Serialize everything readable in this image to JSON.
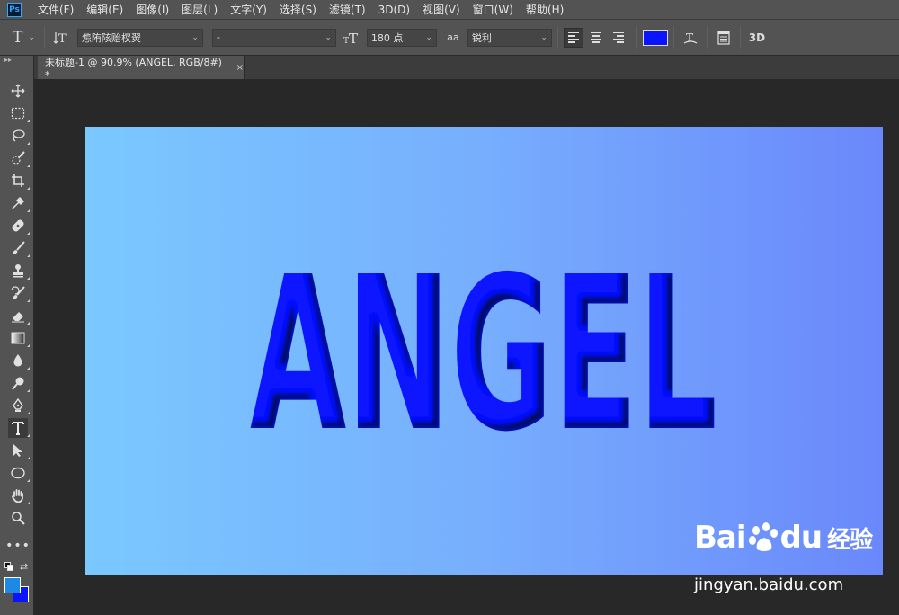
{
  "app": {
    "logo_text": "Ps"
  },
  "menu": {
    "items": [
      "文件(F)",
      "编辑(E)",
      "图像(I)",
      "图层(L)",
      "文字(Y)",
      "选择(S)",
      "滤镜(T)",
      "3D(D)",
      "视图(V)",
      "窗口(W)",
      "帮助(H)"
    ]
  },
  "options": {
    "tool_icon": "T",
    "font_family": "怹陏陔贻杈翜",
    "font_style": "-",
    "font_size": "180 点",
    "antialias_icon": "aa",
    "antialias": "锐利",
    "color": "#0a14ff",
    "threed_label": "3D"
  },
  "document": {
    "tab_title": "未标题-1 @ 90.9% (ANGEL, RGB/8#) *",
    "close_glyph": "×",
    "canvas_text": "ANGEL",
    "text_color": "#0a14ff",
    "gradient_start": "#7ac8ff",
    "gradient_end": "#6a88fb"
  },
  "colors": {
    "foreground": "#1e88e5",
    "background": "#0a14ff"
  },
  "watermark": {
    "logo_left": "Bai",
    "logo_right": "du",
    "logo_suffix": "经验",
    "url": "jingyan.baidu.com"
  }
}
